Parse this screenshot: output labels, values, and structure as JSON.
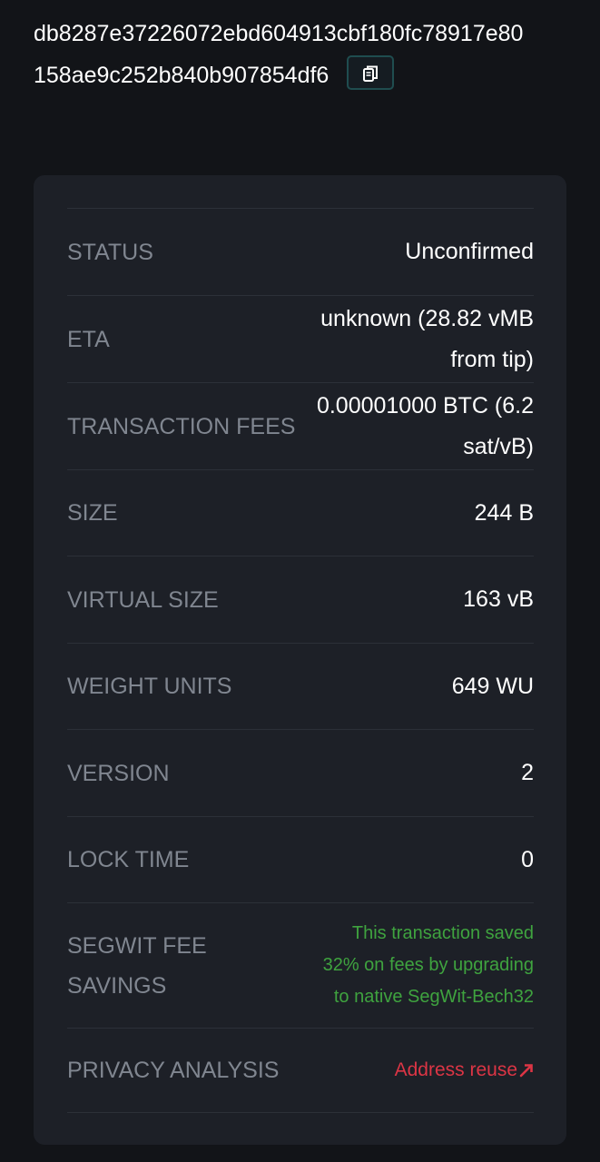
{
  "transaction": {
    "txid_line1": "db8287e37226072ebd604913cbf180fc78917e80",
    "txid_line2": "158ae9c252b840b907854df6"
  },
  "details": {
    "status": {
      "label": "STATUS",
      "value": "Unconfirmed"
    },
    "eta": {
      "label": "ETA",
      "value_line1": "unknown (28.82 vMB",
      "value_line2": "from tip)"
    },
    "fees": {
      "label": "TRANSACTION FEES",
      "value_line1": "0.00001000 BTC (6.2",
      "value_line2": "sat/vB)"
    },
    "size": {
      "label": "SIZE",
      "value": "244 B"
    },
    "virtual_size": {
      "label": "VIRTUAL SIZE",
      "value": "163 vB"
    },
    "weight_units": {
      "label": "WEIGHT UNITS",
      "value": "649 WU"
    },
    "version": {
      "label": "VERSION",
      "value": "2"
    },
    "lock_time": {
      "label": "LOCK TIME",
      "value": "0"
    },
    "segwit": {
      "label_line1": "SEGWIT FEE",
      "label_line2": "SAVINGS",
      "value_line1": "This transaction saved",
      "value_line2": "32% on fees by upgrading",
      "value_line3": "to native SegWit-Bech32"
    },
    "privacy": {
      "label": "PRIVACY ANALYSIS",
      "value": "Address reuse"
    }
  },
  "colors": {
    "background": "#121418",
    "card": "#1d2027",
    "label": "#808690",
    "success": "#3fa33f",
    "danger": "#dc3545"
  },
  "icons": [
    "copy-icon",
    "external-link-arrow-icon"
  ]
}
